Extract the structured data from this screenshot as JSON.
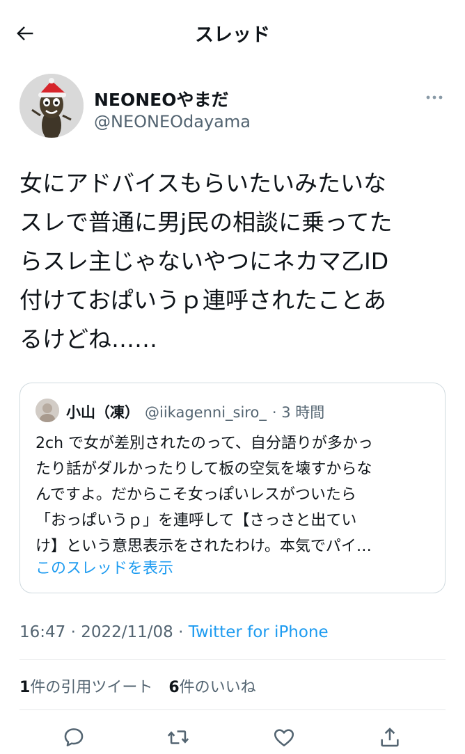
{
  "header": {
    "title": "スレッド"
  },
  "author": {
    "display_name": "NEONEOやまだ",
    "handle": "@NEONEOdayama"
  },
  "tweet": {
    "lines": [
      "女にアドバイスもらいたいみたいな",
      "スレで普通に男j民の相談に乗ってた",
      "らスレ主じゃないやつにネカマ乙ID",
      "付けておぱいうｐ連呼されたことあ",
      "るけどね……"
    ]
  },
  "quoted": {
    "name": "小山（凍）",
    "handle": "@iikagenni_siro_",
    "time": "· 3 時間",
    "lines": [
      "2ch で女が差別されたのって、自分語りが多かっ",
      "たり話がダルかったりして板の空気を壊すからな",
      "んですよ。だからこそ女っぽいレスがついたら",
      "「おっぱいうｐ」を連呼して【さっさと出てい",
      "け】という意思表示をされたわけ。本気でパイ…"
    ],
    "show_thread": "このスレッドを表示"
  },
  "meta": {
    "time": "16:47 · 2022/11/08 · ",
    "source": "Twitter for iPhone"
  },
  "stats": {
    "quotes_count": "1",
    "quotes_label": "件の引用ツイート",
    "likes_count": "6",
    "likes_label": "件のいいね"
  },
  "icons": {
    "back": "arrow-left-icon",
    "more": "more-horizontal-icon",
    "reply": "reply-icon",
    "retweet": "retweet-icon",
    "like": "heart-icon",
    "share": "share-icon"
  },
  "colors": {
    "text": "#0f1419",
    "secondary": "#536471",
    "link": "#1d9bf0",
    "border": "#cfd9de"
  }
}
